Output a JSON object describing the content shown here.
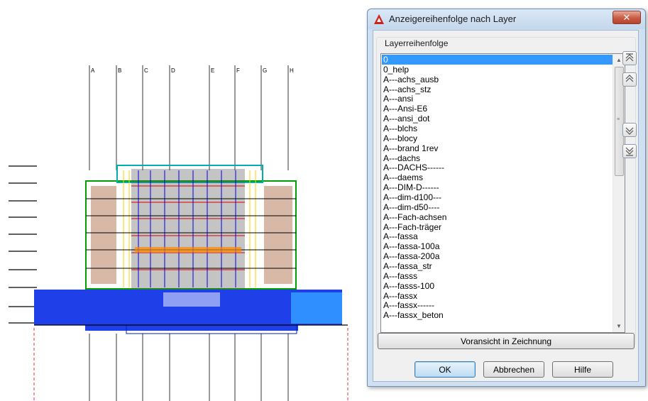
{
  "dialog": {
    "title": "Anzeigereihenfolge nach Layer",
    "close_label": "✕",
    "group_label": "Layerreihenfolge",
    "selected_index": 0,
    "layers": [
      "0",
      "0_help",
      "A---achs_ausb",
      "A---achs_stz",
      "A---ansi",
      "A---Ansi-E6",
      "A---ansi_dot",
      "A---blchs",
      "A---blocy",
      "A---brand 1rev",
      "A---dachs",
      "A---DACHS------",
      "A---daems",
      "A---DIM-D------",
      "A---dim-d100---",
      "A---dim-d50----",
      "A---Fach-achsen",
      "A---Fach-träger",
      "A---fassa",
      "A---fassa-100a",
      "A---fassa-200a",
      "A---fassa_str",
      "A---fasss",
      "A---fasss-100",
      "A---fassx",
      "A---fassx------",
      "A---fassx_beton"
    ],
    "preview_button": "Voransicht in Zeichnung",
    "ok_button": "OK",
    "cancel_button": "Abbrechen",
    "help_button": "Hilfe",
    "side_buttons": [
      "move-to-top-icon",
      "move-up-icon",
      "move-down-icon",
      "move-to-bottom-icon"
    ]
  },
  "drawing": {
    "axis_labels": [
      "A",
      "B",
      "C",
      "D",
      "E",
      "F",
      "G",
      "H"
    ]
  },
  "colors": {
    "selection": "#3399ff",
    "titlebar": "#c4d7ec",
    "close": "#c75b45"
  }
}
